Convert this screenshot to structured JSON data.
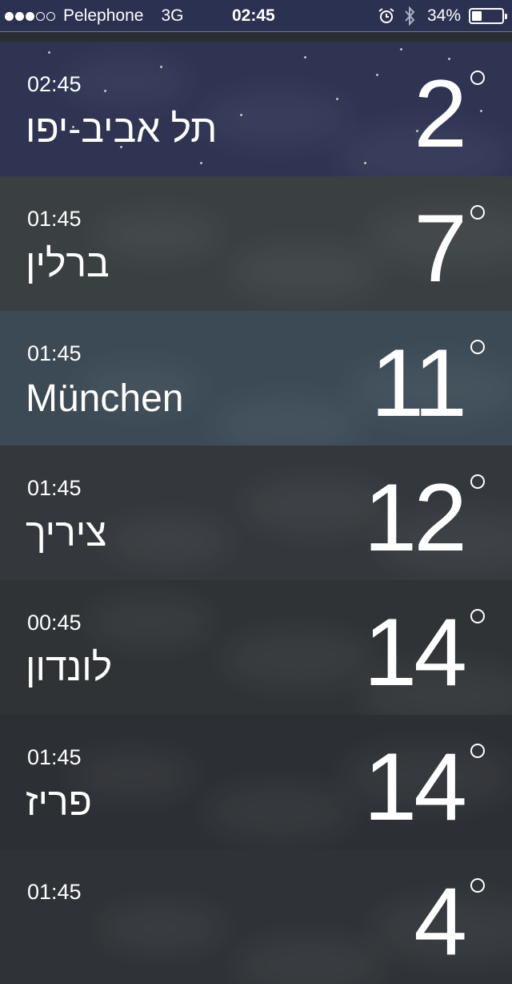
{
  "status_bar": {
    "carrier": "Pelephone",
    "network": "3G",
    "time": "02:45",
    "battery_percent": "34%",
    "battery_level": 0.34,
    "signal_bars": 3
  },
  "cities": [
    {
      "time": "02:45",
      "name": "תל אביב-יפו",
      "temp": "2",
      "bg": "#2e3452"
    },
    {
      "time": "01:45",
      "name": "ברלין",
      "temp": "7",
      "bg": "#3a3f42"
    },
    {
      "time": "01:45",
      "name": "München",
      "temp": "11",
      "bg": "#3b4a55"
    },
    {
      "time": "01:45",
      "name": "ציריך",
      "temp": "12",
      "bg": "#34383c"
    },
    {
      "time": "00:45",
      "name": "לונדון",
      "temp": "14",
      "bg": "#303336"
    },
    {
      "time": "01:45",
      "name": "פריז",
      "temp": "14",
      "bg": "#2c2f33"
    },
    {
      "time": "01:45",
      "name": "",
      "temp": "4",
      "bg": "#2f3337"
    }
  ]
}
